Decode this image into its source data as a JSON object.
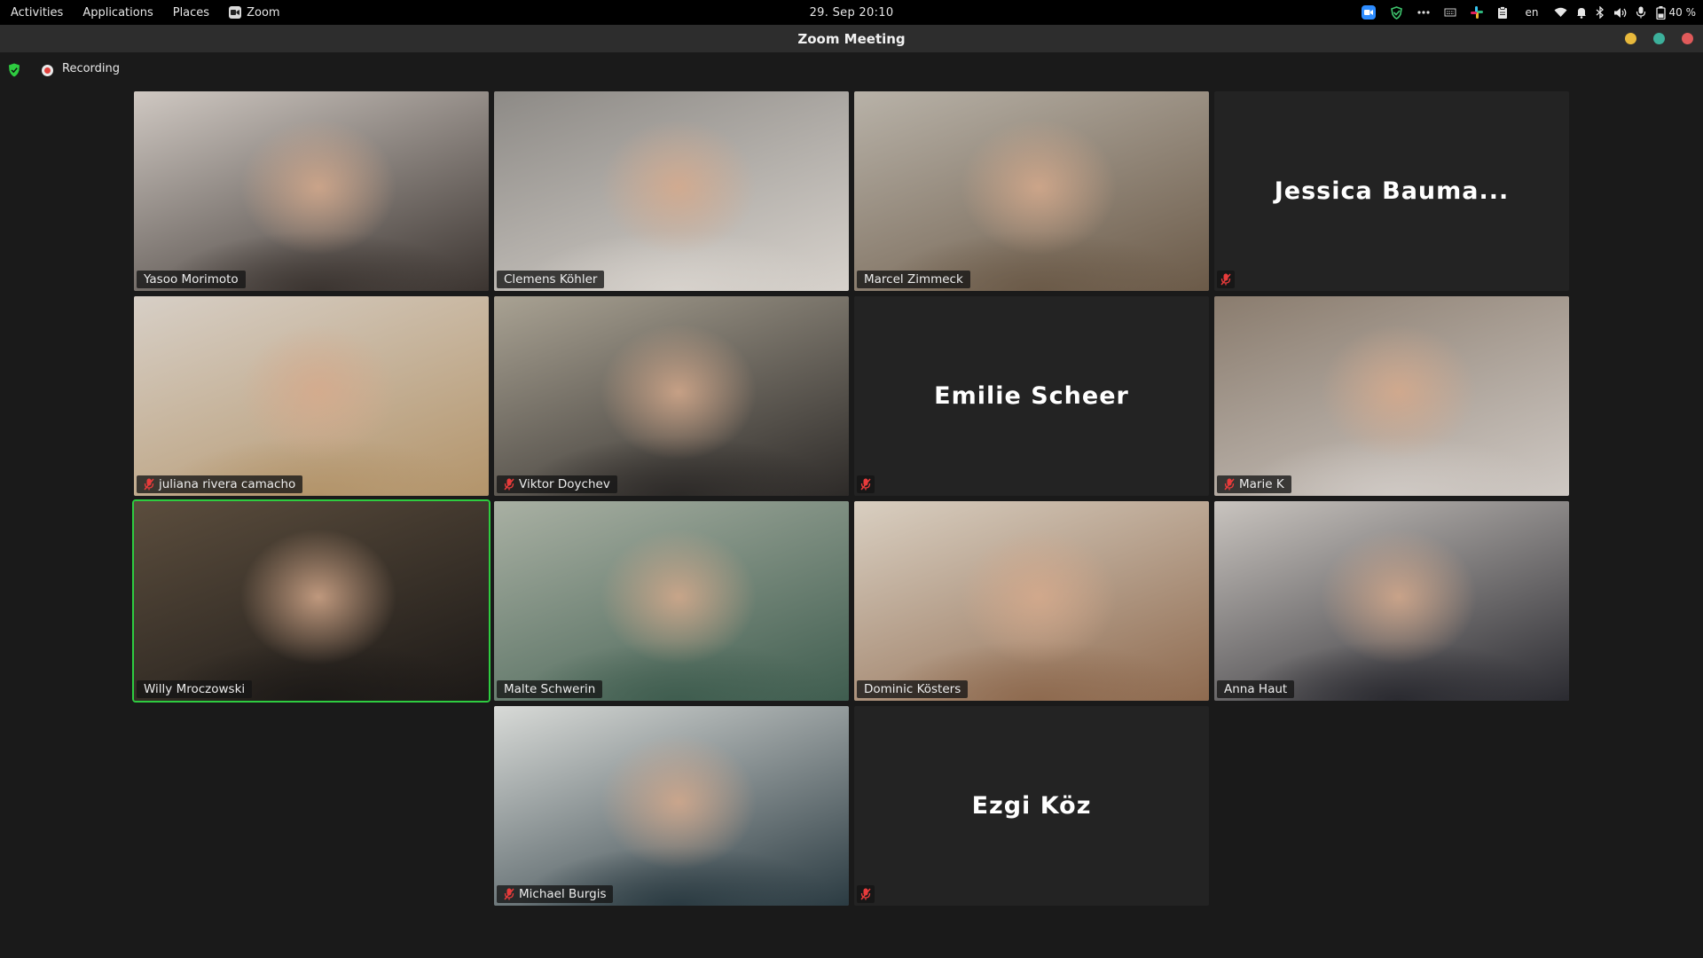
{
  "topbar": {
    "activities": "Activities",
    "applications": "Applications",
    "places": "Places",
    "app_name": "Zoom",
    "datetime": "29. Sep  20:10",
    "keyboard_layout": "en",
    "battery": "40 %"
  },
  "window": {
    "title": "Zoom Meeting",
    "controls": {
      "minimize_color": "#e8b93c",
      "maximize_color": "#3cb09b",
      "close_color": "#e05a5a"
    }
  },
  "recording": {
    "label": "Recording",
    "shield_color": "#2ecc40",
    "dot_color": "#e0403c"
  },
  "participants": [
    {
      "name": "Yasoo Morimoto",
      "video": true,
      "muted": false,
      "active": false,
      "tone": [
        "#cfc8c2",
        "#3b3430"
      ]
    },
    {
      "name": "Clemens Köhler",
      "video": true,
      "muted": false,
      "active": false,
      "tone": [
        "#8d8a86",
        "#d7d2cc"
      ]
    },
    {
      "name": "Marcel Zimmeck",
      "video": true,
      "muted": false,
      "active": false,
      "tone": [
        "#b8b2a8",
        "#6b5a48"
      ]
    },
    {
      "name": "Jessica Bauma...",
      "video": false,
      "muted": true,
      "active": false
    },
    {
      "name": "juliana rivera camacho",
      "video": true,
      "muted": true,
      "active": false,
      "tone": [
        "#d7cfc6",
        "#b3946a"
      ]
    },
    {
      "name": "Viktor Doychev",
      "video": true,
      "muted": true,
      "active": false,
      "tone": [
        "#a9a293",
        "#2d2a28"
      ]
    },
    {
      "name": "Emilie Scheer",
      "video": false,
      "muted": true,
      "active": false
    },
    {
      "name": "Marie K",
      "video": true,
      "muted": true,
      "active": false,
      "tone": [
        "#8a7c6e",
        "#cfc9c4"
      ]
    },
    {
      "name": "Willy Mroczowski",
      "video": true,
      "muted": false,
      "active": true,
      "tone": [
        "#5b4d3d",
        "#1c1917"
      ]
    },
    {
      "name": "Malte Schwerin",
      "video": true,
      "muted": false,
      "active": false,
      "tone": [
        "#a9b0a3",
        "#3f5d4f"
      ]
    },
    {
      "name": "Dominic Kösters",
      "video": true,
      "muted": false,
      "active": false,
      "tone": [
        "#d9cfc1",
        "#8e6a4f"
      ]
    },
    {
      "name": "Anna Haut",
      "video": true,
      "muted": false,
      "active": false,
      "tone": [
        "#c9c4bf",
        "#2a2a30"
      ]
    },
    {
      "name": "Michael Burgis",
      "video": true,
      "muted": true,
      "active": false,
      "tone": [
        "#d8dad7",
        "#2b3b42"
      ]
    },
    {
      "name": "Ezgi Köz",
      "video": false,
      "muted": true,
      "active": false
    }
  ]
}
